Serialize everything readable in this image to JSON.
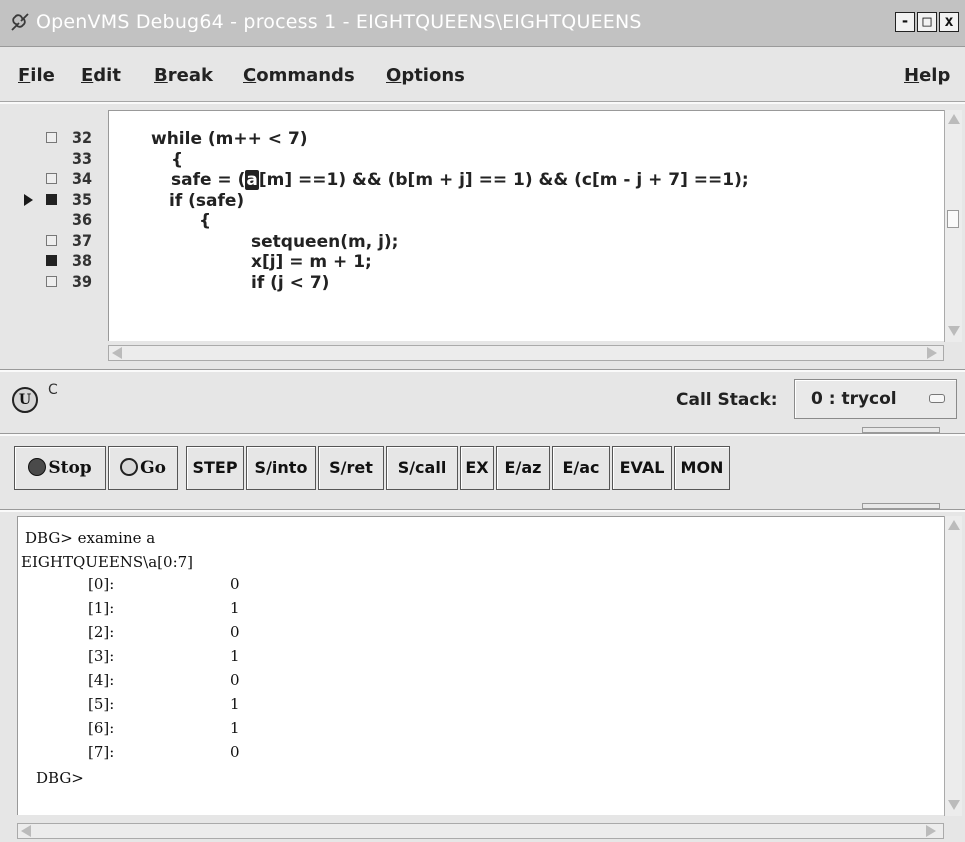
{
  "window": {
    "title": "OpenVMS Debug64 - process 1 - EIGHTQUEENS\\EIGHTQUEENS",
    "minimize_glyph": "-",
    "maximize_glyph": "□",
    "close_glyph": "x"
  },
  "menu": {
    "items": [
      {
        "label": "File",
        "mnemonic": "F"
      },
      {
        "label": "Edit",
        "mnemonic": "E"
      },
      {
        "label": "Break",
        "mnemonic": "B"
      },
      {
        "label": "Commands",
        "mnemonic": "C"
      },
      {
        "label": "Options",
        "mnemonic": "O"
      }
    ],
    "help": {
      "label": "Help",
      "mnemonic": "H"
    }
  },
  "source": {
    "lines": [
      {
        "number": "32",
        "breakpoint_box": true,
        "breakpoint_set": false,
        "current": false,
        "code_pre": "",
        "code_hl": "",
        "code_post": "while (m++ < 7)"
      },
      {
        "number": "33",
        "breakpoint_box": false,
        "breakpoint_set": false,
        "current": false,
        "code_pre": "",
        "code_hl": "",
        "code_post": "{"
      },
      {
        "number": "34",
        "breakpoint_box": true,
        "breakpoint_set": false,
        "current": false,
        "code_pre": "safe = (",
        "code_hl": "a",
        "code_post": "[m] ==1) && (b[m + j] == 1) && (c[m - j + 7] ==1);"
      },
      {
        "number": "35",
        "breakpoint_box": true,
        "breakpoint_set": true,
        "current": true,
        "code_pre": "",
        "code_hl": "",
        "code_post": "if (safe)"
      },
      {
        "number": "36",
        "breakpoint_box": false,
        "breakpoint_set": false,
        "current": false,
        "code_pre": "",
        "code_hl": "",
        "code_post": "{"
      },
      {
        "number": "37",
        "breakpoint_box": true,
        "breakpoint_set": false,
        "current": false,
        "code_pre": "",
        "code_hl": "",
        "code_post": "setqueen(m, j);"
      },
      {
        "number": "38",
        "breakpoint_box": true,
        "breakpoint_set": true,
        "current": false,
        "code_pre": "",
        "code_hl": "",
        "code_post": "x[j] = m + 1;"
      },
      {
        "number": "39",
        "breakpoint_box": true,
        "breakpoint_set": false,
        "current": false,
        "code_pre": "",
        "code_hl": "",
        "code_post": "if (j < 7)"
      }
    ]
  },
  "status": {
    "mode_icon": "U",
    "mode_text": "C",
    "call_stack_label": "Call Stack:",
    "call_stack_value": "0 : trycol"
  },
  "toolbar": {
    "buttons": [
      {
        "label": "Stop",
        "icon": "stop-dot-icon"
      },
      {
        "label": "Go",
        "icon": "go-dot-icon"
      },
      {
        "label": "STEP"
      },
      {
        "label": "S/into"
      },
      {
        "label": "S/ret"
      },
      {
        "label": "S/call"
      },
      {
        "label": "EX"
      },
      {
        "label": "E/az"
      },
      {
        "label": "E/ac"
      },
      {
        "label": "EVAL"
      },
      {
        "label": "MON"
      }
    ]
  },
  "output": {
    "command": "DBG> examine a",
    "symbol": "EIGHTQUEENS\\a[0:7]",
    "rows": [
      {
        "index": "[0]:",
        "value": "0"
      },
      {
        "index": "[1]:",
        "value": "1"
      },
      {
        "index": "[2]:",
        "value": "0"
      },
      {
        "index": "[3]:",
        "value": "1"
      },
      {
        "index": "[4]:",
        "value": "0"
      },
      {
        "index": "[5]:",
        "value": "1"
      },
      {
        "index": "[6]:",
        "value": "1"
      },
      {
        "index": "[7]:",
        "value": "0"
      }
    ],
    "prompt": "DBG>"
  },
  "colors": {
    "title_bar": "#c2c2c2",
    "window_bg": "#e6e6e6",
    "pane_bg": "#ffffff",
    "stop_icon": "#4a4a4a",
    "go_icon": "#d9d9d9"
  }
}
